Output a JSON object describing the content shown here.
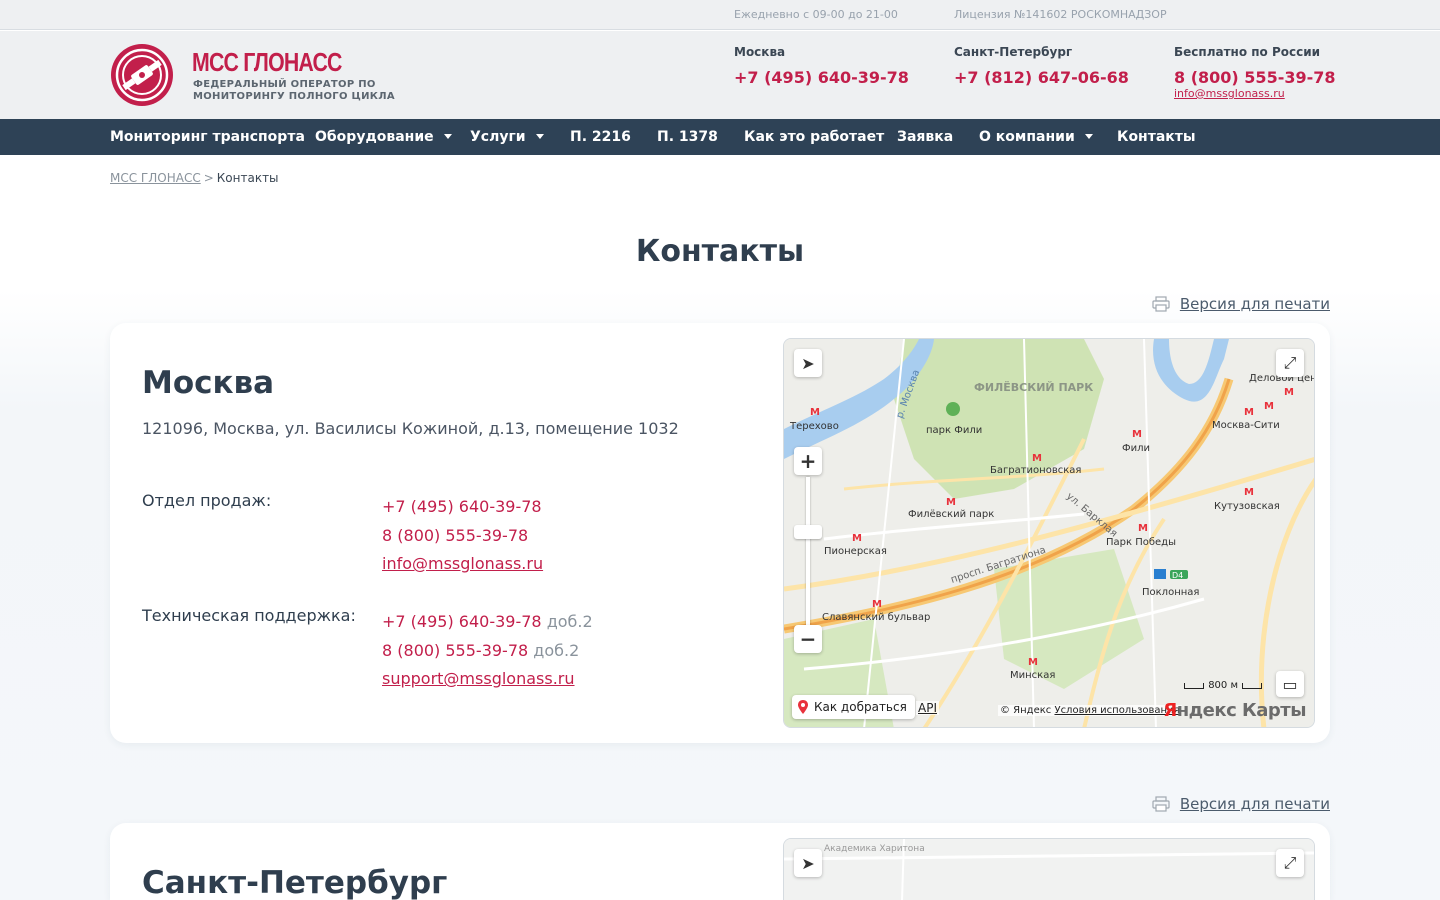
{
  "topbar": {
    "hours": "Ежедневно с 09-00 до 21-00",
    "license": "Лицензия №141602 РОСКОМНАДЗОР"
  },
  "header": {
    "logo_name": "МСС ГЛОНАСС",
    "logo_tagline": "ФЕДЕРАЛЬНЫЙ ОПЕРАТОР ПО МОНИТОРИНГУ ПОЛНОГО ЦИКЛА",
    "contacts": [
      {
        "city": "Москва",
        "phone": "+7 (495) 640-39-78"
      },
      {
        "city": "Санкт-Петербург",
        "phone": "+7 (812) 647-06-68"
      },
      {
        "city": "Бесплатно по России",
        "phone": "8 (800) 555-39-78",
        "email": "info@mssglonass.ru"
      }
    ]
  },
  "nav": {
    "items": [
      {
        "label": "Мониторинг транспорта"
      },
      {
        "label": "Оборудование"
      },
      {
        "label": "Услуги"
      },
      {
        "label": "П. 2216"
      },
      {
        "label": "П. 1378"
      },
      {
        "label": "Как это работает"
      },
      {
        "label": "Заявка"
      },
      {
        "label": "О компании"
      },
      {
        "label": "Контакты"
      }
    ]
  },
  "breadcrumb": {
    "home": "МСС ГЛОНАСС",
    "separator": ">",
    "current": "Контакты"
  },
  "page_title": "Контакты",
  "print_label": "Версия для печати",
  "offices": [
    {
      "city": "Москва",
      "address": "121096, Москва, ул. Василисы Кожиной, д.13, помещение 1032",
      "sales_label": "Отдел продаж:",
      "sales_phone1": "+7 (495) 640-39-78",
      "sales_phone2": "8 (800) 555-39-78",
      "sales_email": "info@mssglonass.ru",
      "support_label": "Техническая поддержка:",
      "support_phone1": "+7 (495) 640-39-78",
      "support_phone2": "8 (800) 555-39-78",
      "support_ext": "доб.2",
      "support_email": "support@mssglonass.ru"
    },
    {
      "city": "Санкт-Петербург"
    }
  ],
  "map": {
    "route_label": "Как добраться",
    "api_label": "API",
    "copyright": "© Яндекс",
    "terms": "Условия использования",
    "brand_y": "Я",
    "brand_rest": "ндекс Карты",
    "scale_label": "800 м",
    "labels": {
      "park": "ФИЛЁВСКИЙ ПАРК",
      "park_fili": "парк Фили",
      "terehovo": "Терехово",
      "fili": "Фили",
      "bagrat": "Багратионовская",
      "filpark": "Филёвский парк",
      "pioner": "Пионерская",
      "slav": "Славянский бульвар",
      "minsk": "Минская",
      "poklon": "Поклонная",
      "pobedy": "Парк Победы",
      "kutuz": "Кутузовская",
      "mcity": "Москва-Сити",
      "delovoy": "Деловой цен",
      "barklaya": "ул. Барклая",
      "prosp": "просп. Багратиона",
      "river": "р. Москва",
      "d4": "D4",
      "akad": "Академика Харитона"
    }
  },
  "colors": {
    "brand": "#c21f4b",
    "nav_bg": "#2e4256",
    "text": "#2f3e4e"
  }
}
